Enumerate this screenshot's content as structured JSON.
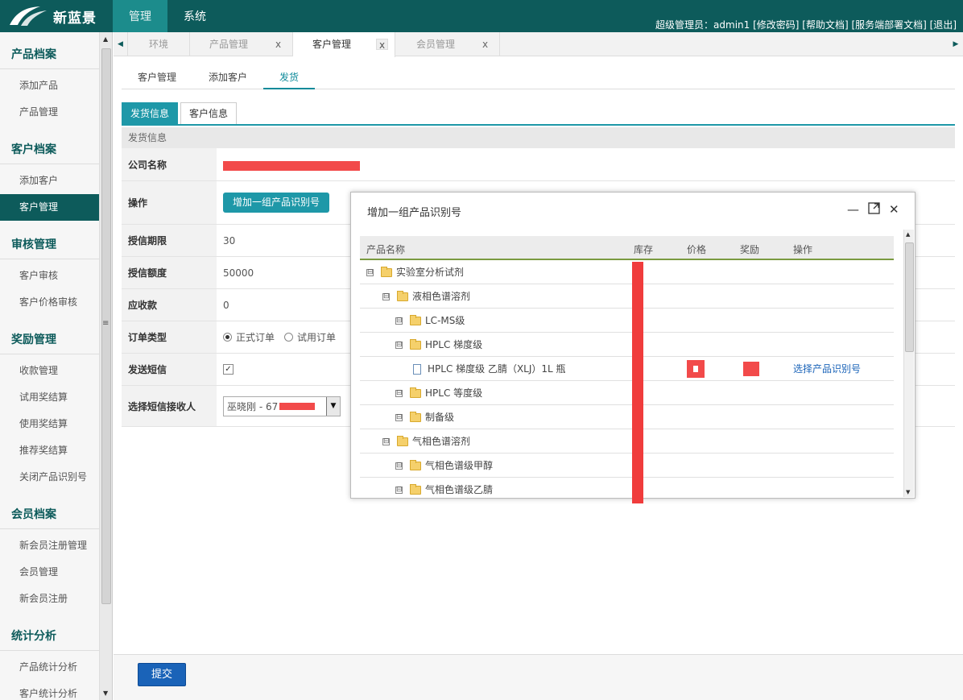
{
  "app": {
    "logo_text": "新蓝景"
  },
  "topnav": [
    {
      "label": "管理",
      "active": true
    },
    {
      "label": "系统",
      "active": false
    }
  ],
  "userbar": "超级管理员：admin1 [修改密码] [帮助文档] [服务端部署文档] [退出]",
  "sidebar": {
    "groups": [
      {
        "title": "产品档案",
        "items": [
          "添加产品",
          "产品管理"
        ]
      },
      {
        "title": "客户档案",
        "items": [
          "添加客户",
          "客户管理"
        ]
      },
      {
        "title": "审核管理",
        "items": [
          "客户审核",
          "客户价格审核"
        ]
      },
      {
        "title": "奖励管理",
        "items": [
          "收款管理",
          "试用奖结算",
          "使用奖结算",
          "推荐奖结算",
          "关闭产品识别号"
        ]
      },
      {
        "title": "会员档案",
        "items": [
          "新会员注册管理",
          "会员管理",
          "新会员注册"
        ]
      },
      {
        "title": "统计分析",
        "items": [
          "产品统计分析",
          "客户统计分析"
        ]
      }
    ],
    "active_item": "客户管理"
  },
  "tabs": [
    {
      "label": "环境",
      "close": ""
    },
    {
      "label": "产品管理",
      "close": "x"
    },
    {
      "label": "客户管理",
      "close": "x",
      "active": true
    },
    {
      "label": "会员管理",
      "close": "x"
    }
  ],
  "subnav": [
    {
      "label": "客户管理"
    },
    {
      "label": "添加客户"
    },
    {
      "label": "发货",
      "active": true
    }
  ],
  "form_tabs": [
    {
      "label": "发货信息",
      "active": true
    },
    {
      "label": "客户信息"
    }
  ],
  "form": {
    "section_title": "发货信息",
    "company_label": "公司名称",
    "operation_label": "操作",
    "operation_button": "增加一组产品识别号",
    "credit_period_label": "授信期限",
    "credit_period_value": "30",
    "credit_limit_label": "授信额度",
    "credit_limit_value": "50000",
    "receivable_label": "应收款",
    "receivable_value": "0",
    "order_type_label": "订单类型",
    "order_type_options": [
      "正式订单",
      "试用订单"
    ],
    "sms_label": "发送短信",
    "sms_checked": "✓",
    "sms_recipient_label": "选择短信接收人",
    "sms_recipient_value": "巫晓刚 - 67",
    "dropdown_arrow": "▼"
  },
  "submit_label": "提交",
  "modal": {
    "title": "增加一组产品识别号",
    "columns": [
      "产品名称",
      "库存",
      "价格",
      "奖励",
      "操作"
    ],
    "toggle_symbol": "⊟",
    "rows": [
      {
        "level": 0,
        "type": "folder",
        "name": "实验室分析试剂"
      },
      {
        "level": 1,
        "type": "folder",
        "name": "液相色谱溶剂"
      },
      {
        "level": 2,
        "type": "folder",
        "name": "LC-MS级"
      },
      {
        "level": 2,
        "type": "folder",
        "name": "HPLC 梯度级"
      },
      {
        "level": 3,
        "type": "file",
        "name": "HPLC 梯度级 乙腈（XLJ）1L 瓶",
        "action": "选择产品识别号"
      },
      {
        "level": 2,
        "type": "folder",
        "name": "HPLC 等度级"
      },
      {
        "level": 2,
        "type": "folder",
        "name": "制备级"
      },
      {
        "level": 1,
        "type": "folder",
        "name": "气相色谱溶剂"
      },
      {
        "level": 2,
        "type": "folder",
        "name": "气相色谱级甲醇"
      },
      {
        "level": 2,
        "type": "folder",
        "name": "气相色谱级乙腈"
      }
    ]
  },
  "colors": {
    "brand": "#0d5b5b",
    "accent": "#1e98a8",
    "submit": "#1a63b8",
    "redaction": "#f24a4a"
  }
}
